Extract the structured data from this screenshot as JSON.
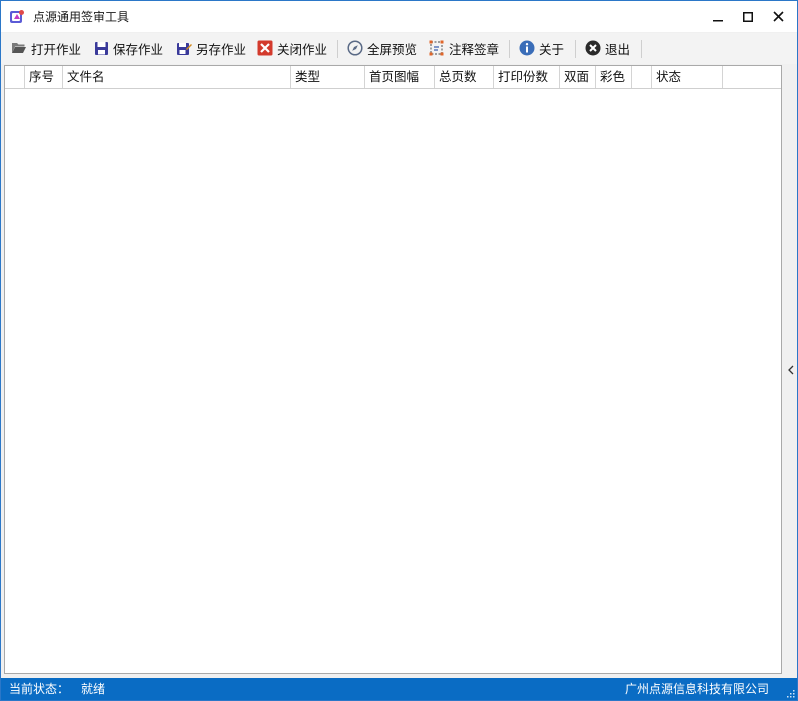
{
  "window": {
    "title": "点源通用签审工具",
    "controls": {
      "minimize_icon": "minimize-icon",
      "maximize_icon": "maximize-icon",
      "close_icon": "close-icon"
    }
  },
  "toolbar": {
    "items": [
      {
        "label": "打开作业",
        "icon": "folder-open-icon"
      },
      {
        "label": "保存作业",
        "icon": "save-icon"
      },
      {
        "label": "另存作业",
        "icon": "save-as-icon"
      },
      {
        "label": "关闭作业",
        "icon": "close-job-icon"
      },
      {
        "label": "全屏预览",
        "icon": "compass-icon"
      },
      {
        "label": "注释签章",
        "icon": "annotate-icon"
      },
      {
        "label": "关于",
        "icon": "info-icon"
      },
      {
        "label": "退出",
        "icon": "exit-icon"
      }
    ]
  },
  "grid": {
    "columns": [
      "",
      "序号",
      "文件名",
      "类型",
      "首页图幅",
      "总页数",
      "打印份数",
      "双面",
      "彩色",
      "",
      "状态",
      ""
    ],
    "rows": []
  },
  "statusbar": {
    "label": "当前状态：",
    "value": "就绪",
    "company": "广州点源信息科技有限公司"
  },
  "colors": {
    "accent": "#0a6cc4",
    "border": "#2b77c8",
    "save_icon": "#3a3a9a",
    "close_icon": "#d33a2c"
  }
}
